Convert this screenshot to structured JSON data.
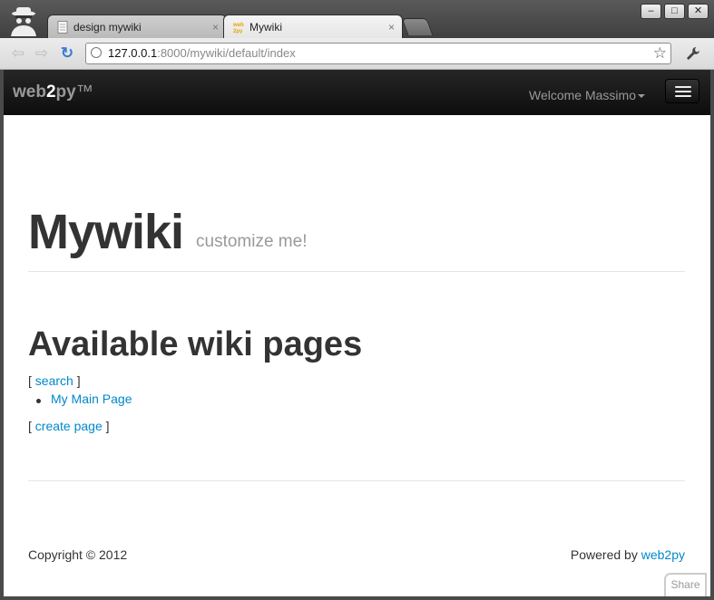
{
  "tabs": [
    {
      "title": "design mywiki",
      "close": "×"
    },
    {
      "title": "Mywiki",
      "close": "×",
      "favicon_text": "web2py"
    }
  ],
  "window_controls": {
    "minimize": "–",
    "maximize": "□",
    "close": "✕"
  },
  "toolbar": {
    "back_glyph": "⇦",
    "forward_glyph": "⇨",
    "reload_glyph": "↻",
    "url_host": "127.0.0.1",
    "url_rest": ":8000/mywiki/default/index",
    "star_glyph": "☆",
    "wrench_glyph": "🔧"
  },
  "navbar": {
    "brand_prefix": "web",
    "brand_two": "2",
    "brand_suffix": "py",
    "brand_tm": "™",
    "welcome": "Welcome Massimo"
  },
  "page": {
    "title": "Mywiki",
    "subtitle": "customize me!",
    "section_heading": "Available wiki pages",
    "search_open": "[ ",
    "search_link": "search",
    "search_close": " ]",
    "wiki_pages": [
      "My Main Page"
    ],
    "create_open": "[ ",
    "create_link": "create page",
    "create_close": " ]"
  },
  "footer": {
    "copyright": "Copyright © 2012",
    "powered_prefix": "Powered by ",
    "powered_link": "web2py"
  },
  "share_label": "Share",
  "colors": {
    "link": "#0088cc",
    "navbar": "#1b1b1b",
    "heading": "#333333",
    "muted": "#999999"
  }
}
